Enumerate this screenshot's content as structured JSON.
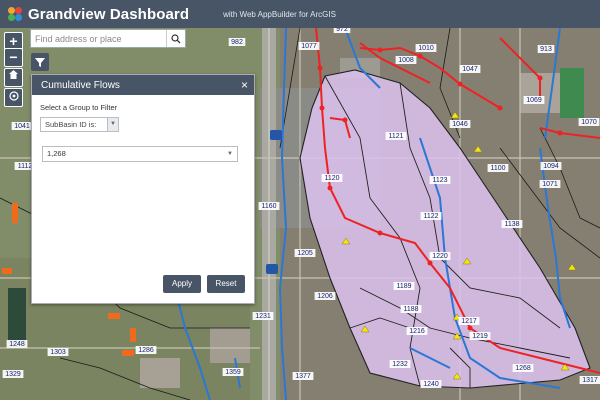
{
  "header": {
    "title": "Grandview Dashboard",
    "subtitle": "with Web AppBuilder for ArcGIS"
  },
  "map_controls": {
    "zoom_in": "+",
    "zoom_out": "−"
  },
  "search": {
    "placeholder": "Find address or place"
  },
  "panel": {
    "title": "Cumulative Flows",
    "close": "×",
    "filter_label": "Select a Group to Filter",
    "group_value": "SubBasin ID is:",
    "value": "1,268",
    "apply_label": "Apply",
    "reset_label": "Reset"
  },
  "map_labels": [
    "982",
    "1077",
    "972",
    "1010",
    "913",
    "1008",
    "1047",
    "1069",
    "1070",
    "1121",
    "1046",
    "1120",
    "1123",
    "1100",
    "1094",
    "1071",
    "1122",
    "1138",
    "1160",
    "1205",
    "1220",
    "1189",
    "1188",
    "1206",
    "1217",
    "1216",
    "1219",
    "1231",
    "1232",
    "1240",
    "1268",
    "1248",
    "1303",
    "1286",
    "1329",
    "1359",
    "1377",
    "1317",
    "1041",
    "1112"
  ],
  "colors": {
    "toolbar": "#485566",
    "subbasin_fill": "#dcc2ef",
    "stream": "#2b77d5",
    "sewer_line": "#ee2222",
    "marker": "#f4e21a"
  }
}
